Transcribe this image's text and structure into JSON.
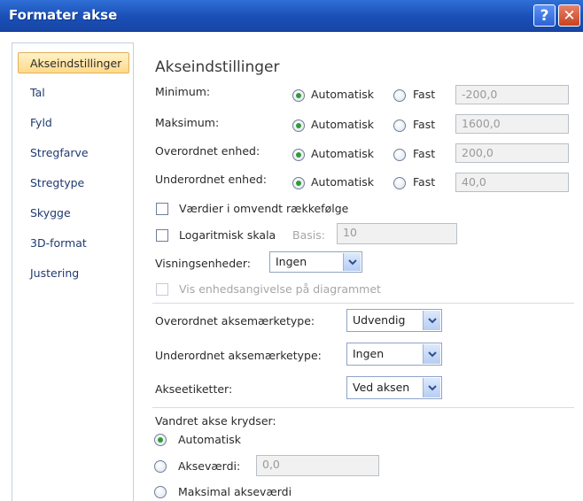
{
  "window": {
    "title": "Formater akse",
    "help_glyph": "?",
    "close_glyph": "✕"
  },
  "nav": {
    "items": [
      "Akseindstillinger",
      "Tal",
      "Fyld",
      "Stregfarve",
      "Stregtype",
      "Skygge",
      "3D-format",
      "Justering"
    ],
    "selected": "Akseindstillinger"
  },
  "panel": {
    "heading": "Akseindstillinger",
    "rows": [
      {
        "label": "Minimum:",
        "auto": "Automatisk",
        "fixed": "Fast",
        "value": "-200,0"
      },
      {
        "label": "Maksimum:",
        "auto": "Automatisk",
        "fixed": "Fast",
        "value": "1600,0"
      },
      {
        "label": "Overordnet enhed:",
        "auto": "Automatisk",
        "fixed": "Fast",
        "value": "200,0"
      },
      {
        "label": "Underordnet enhed:",
        "auto": "Automatisk",
        "fixed": "Fast",
        "value": "40,0"
      }
    ],
    "reverse_order": "Værdier i omvendt rækkefølge",
    "log_scale": "Logaritmisk skala",
    "base_label": "Basis:",
    "base_value": "10",
    "display_units_label": "Visningsenheder:",
    "display_units_value": "Ingen",
    "show_units_label": "Vis enhedsangivelse på diagrammet",
    "major_tick_label": "Overordnet aksemærketype:",
    "major_tick_value": "Udvendig",
    "minor_tick_label": "Underordnet aksemærketype:",
    "minor_tick_value": "Ingen",
    "axis_labels_label": "Akseetiketter:",
    "axis_labels_value": "Ved aksen",
    "crosses_label": "Vandret akse krydser:",
    "crosses_auto": "Automatisk",
    "crosses_value_label": "Akseværdi:",
    "crosses_value": "0,0",
    "crosses_max": "Maksimal akseværdi"
  },
  "colors": {
    "title_bar": "#1a4fb6",
    "selected_nav": "#ffd98a",
    "radio_dot": "#2f9b36"
  }
}
